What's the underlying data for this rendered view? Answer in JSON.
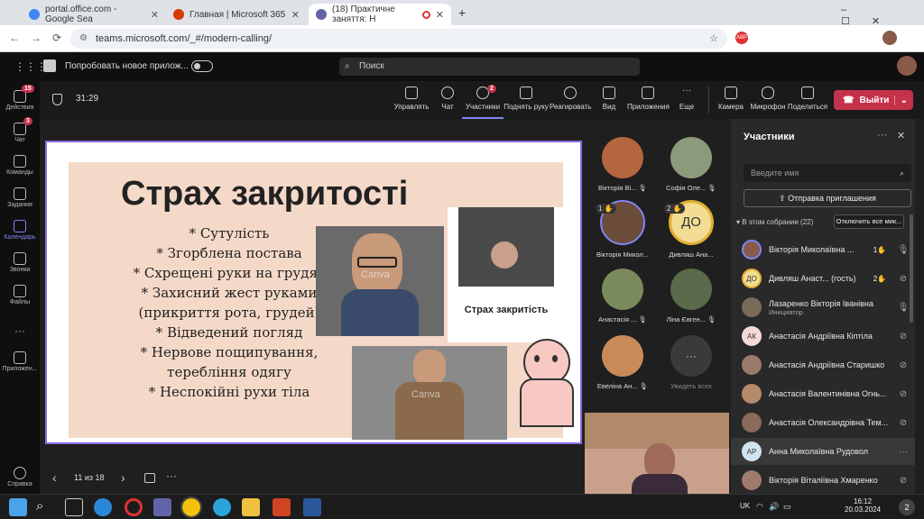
{
  "browser": {
    "tabs": [
      {
        "title": "portal.office.com - Google Sea",
        "icon": "google-icon",
        "color": "#4285f4"
      },
      {
        "title": "Главная | Microsoft 365",
        "icon": "m365-icon",
        "color": "#d83b01"
      },
      {
        "title": "(18) Практичне заняття: Н",
        "icon": "teams-icon",
        "color": "#6264a7"
      }
    ],
    "url": "teams.microsoft.com/_#/modern-calling/"
  },
  "teams": {
    "try_new": "Попробовать новое прилож...",
    "search_placeholder": "Поиск"
  },
  "rail": [
    {
      "label": "Действия",
      "badge": "15"
    },
    {
      "label": "Чат",
      "badge": "3"
    },
    {
      "label": "Команды",
      "badge": ""
    },
    {
      "label": "Задания",
      "badge": ""
    },
    {
      "label": "Календарь",
      "badge": ""
    },
    {
      "label": "Звонки",
      "badge": ""
    },
    {
      "label": "Файлы",
      "badge": ""
    },
    {
      "label": "Приложен...",
      "badge": ""
    },
    {
      "label": "Справка",
      "badge": ""
    }
  ],
  "meeting": {
    "timer": "31:29",
    "buttons": [
      "Управлять",
      "Чат",
      "Участники",
      "Поднять руку",
      "Реагировать",
      "Вид",
      "Приложения",
      "Еще"
    ],
    "participants_badge": "2",
    "media": [
      "Камера",
      "Микрофон",
      "Поделиться"
    ],
    "leave": "Выйти",
    "page": "11 из 18"
  },
  "slide": {
    "title": "Страх закритості",
    "bullets": [
      "* Сутулість",
      "* Згорблена постава",
      "* Схрещені руки на грудях",
      "* Захисний жест руками",
      "(прикриття рота, грудей)",
      "* Відведений погляд",
      "* Нервове пощипування,",
      "теребління одягу",
      "* Неспокійні рухи тіла"
    ],
    "caption": "Страх закритість",
    "watermark": "Canva"
  },
  "gallery": [
    {
      "name": "Вікторія Ві...",
      "color": "#b5653f",
      "hand": ""
    },
    {
      "name": "Софія Оле...",
      "color": "#8b9a7a",
      "hand": ""
    },
    {
      "name": "Вікторія Микол...",
      "color": "#6b4b3a",
      "hand": "1"
    },
    {
      "name": "Дивляш Ана...",
      "initials": "ДО",
      "color": "#f3dc94",
      "hand": "2"
    },
    {
      "name": "Анастасія ...",
      "color": "#7a8a5a",
      "hand": ""
    },
    {
      "name": "Ліна Євген...",
      "color": "#5a6a4a",
      "hand": ""
    },
    {
      "name": "Евеліна Ан...",
      "color": "#c98a5a",
      "hand": ""
    },
    {
      "name": "Увидеть всех",
      "color": "#3a3a3a",
      "hand": ""
    }
  ],
  "panel": {
    "title": "Участники",
    "search_placeholder": "Введите имя",
    "invite": "Отправка приглашения",
    "section": "В этом собрании (22)",
    "mute_all": "Отключить все мик...",
    "people": [
      {
        "name": "Вікторія Миколаївна ...",
        "sub": "",
        "initials": "",
        "color": "#8a5a4a",
        "hand": "1",
        "mic": "on"
      },
      {
        "name": "Дивляш Анаст... (гость)",
        "sub": "",
        "initials": "ДО",
        "color": "#f3dc94",
        "hand": "2",
        "mic": "off"
      },
      {
        "name": "Лазаренко Вікторія Іванівна",
        "sub": "Инициатор",
        "initials": "",
        "color": "#7a6a5a",
        "hand": "",
        "mic": "on"
      },
      {
        "name": "Анастасія Андріївна Кіптіла",
        "sub": "",
        "initials": "АК",
        "color": "#f7d7d7",
        "hand": "",
        "mic": "off"
      },
      {
        "name": "Анастасія Андріївна Старишко",
        "sub": "",
        "initials": "",
        "color": "#9a7a6a",
        "hand": "",
        "mic": "off"
      },
      {
        "name": "Анастасія Валентинівна Огнь...",
        "sub": "",
        "initials": "",
        "color": "#b58a6a",
        "hand": "",
        "mic": "off"
      },
      {
        "name": "Анастасія Олександрівна Тем...",
        "sub": "",
        "initials": "",
        "color": "#8a6a5a",
        "hand": "",
        "mic": "off"
      },
      {
        "name": "Анна Миколаївна Рудовол",
        "sub": "",
        "initials": "АР",
        "color": "#cfe3f0",
        "hand": "",
        "mic": "more"
      },
      {
        "name": "Вікторія Віталіївна Хмаренко",
        "sub": "",
        "initials": "",
        "color": "#a07a6a",
        "hand": "",
        "mic": "off"
      }
    ]
  },
  "taskbar": {
    "lang": "UK",
    "time": "16:12",
    "date": "20.03.2024",
    "notif": "2"
  }
}
